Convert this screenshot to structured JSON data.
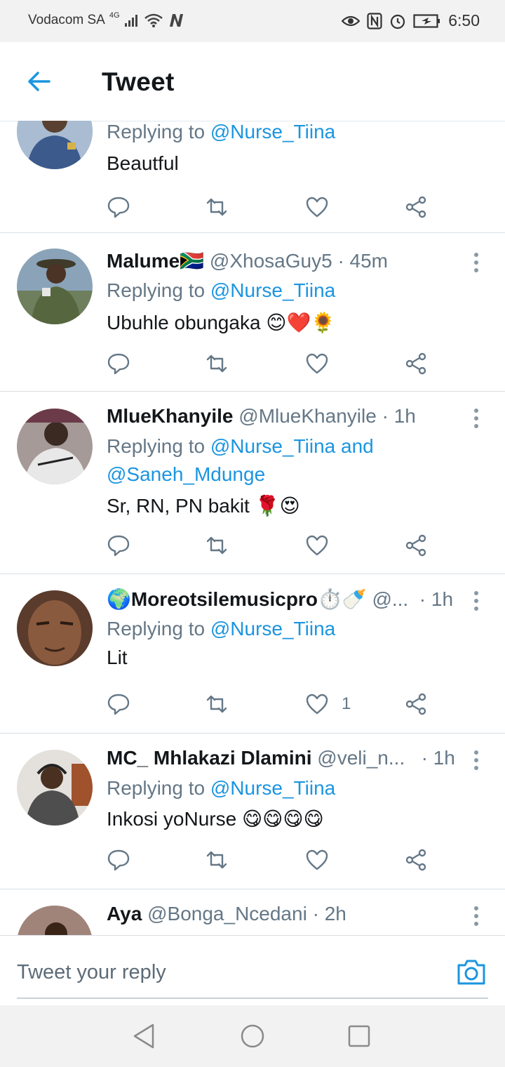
{
  "status": {
    "carrier": "Vodacom SA",
    "network": "4G",
    "time": "6:50"
  },
  "header": {
    "title": "Tweet"
  },
  "tweets": [
    {
      "name": "",
      "handle": "",
      "time": "",
      "replying_prefix": "Replying to ",
      "mentions": "@Nurse_Tiina",
      "text": "Beautful",
      "likes": ""
    },
    {
      "name": "Malume",
      "name_emoji": "🇿🇦",
      "handle": "@XhosaGuy5",
      "time": "· 45m",
      "replying_prefix": "Replying to ",
      "mentions": "@Nurse_Tiina",
      "text": "Ubuhle obungaka",
      "text_emoji": "😊❤️🌻",
      "likes": ""
    },
    {
      "name": "MlueKhanyile",
      "handle": "@MlueKhanyile",
      "time": "· 1h",
      "replying_prefix": "Replying to ",
      "mentions_line1": "@Nurse_Tiina and",
      "mentions_line2": "@Saneh_Mdunge",
      "text": "Sr, RN, PN bakit",
      "text_emoji": "🌹😍",
      "likes": ""
    },
    {
      "name_prefix_emoji": "🌍",
      "name": "Moreotsilemusicpro",
      "name_emoji": "⏱️🍼",
      "handle": "@...",
      "time": "· 1h",
      "replying_prefix": "Replying to ",
      "mentions": "@Nurse_Tiina",
      "text": "Lit",
      "likes": "1"
    },
    {
      "name": "MC_ Mhlakazi Dlamini",
      "handle": "@veli_n...",
      "time": "· 1h",
      "replying_prefix": "Replying to ",
      "mentions": "@Nurse_Tiina",
      "text": "Inkosi yoNurse",
      "text_emoji": "😋😋😋😋",
      "likes": ""
    },
    {
      "name": "Aya",
      "handle": "@Bonga_Ncedani",
      "time": "· 2h"
    }
  ],
  "reply_bar": {
    "placeholder": "Tweet your reply"
  },
  "colors": {
    "accent": "#1b95e0",
    "secondary_text": "#657786",
    "divider": "#d9dfe3"
  },
  "icons": [
    "back-arrow-icon",
    "reply-icon",
    "retweet-icon",
    "like-icon",
    "share-icon",
    "more-icon",
    "camera-icon",
    "nav-back-icon",
    "nav-home-icon",
    "nav-recents-icon"
  ]
}
